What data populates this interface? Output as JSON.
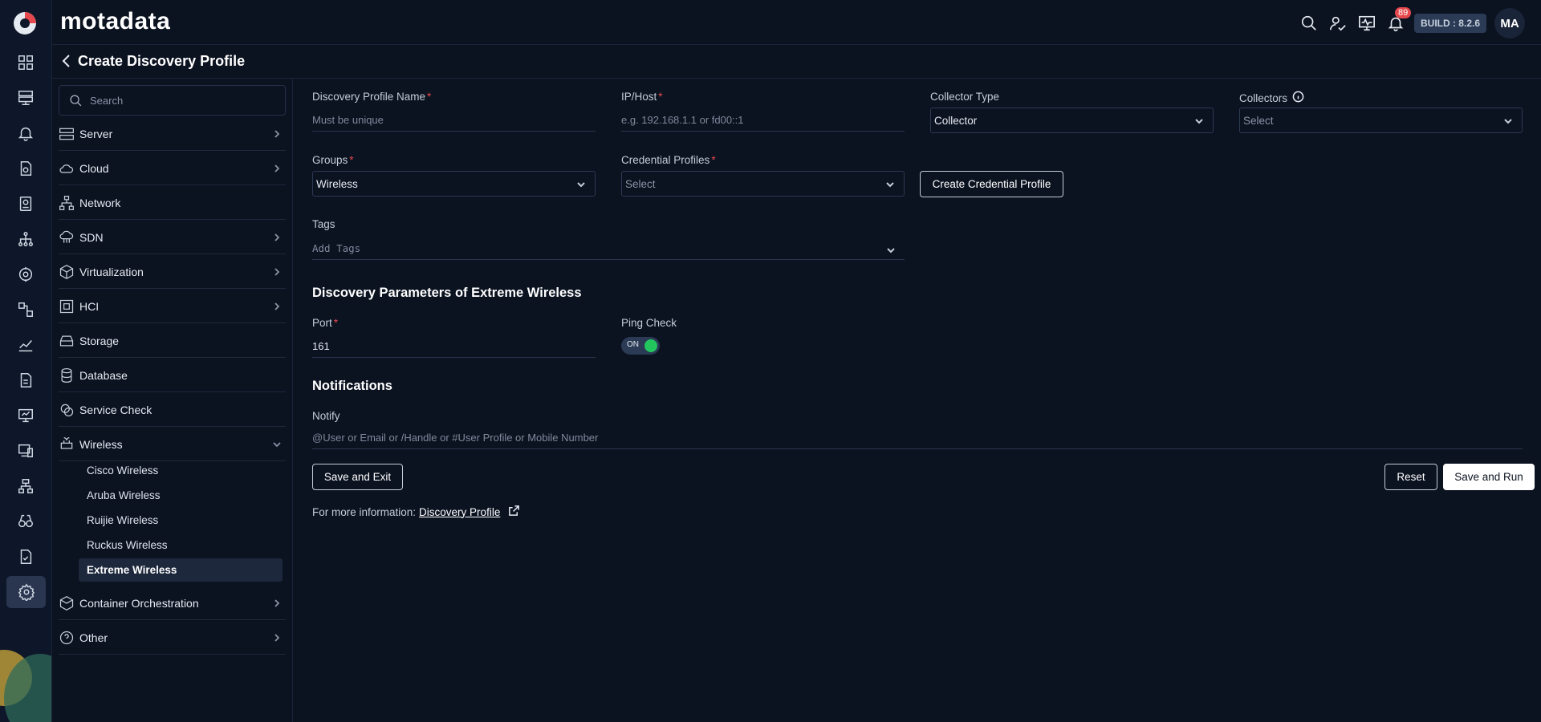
{
  "brand": {
    "name": "motadata"
  },
  "header": {
    "notifications_count": "89",
    "build_label": "BUILD : 8.2.6",
    "avatar_initials": "MA"
  },
  "page": {
    "title": "Create Discovery Profile"
  },
  "sidebar": {
    "search_placeholder": "Search",
    "categories": [
      {
        "label": "Server",
        "icon": "server-icon"
      },
      {
        "label": "Cloud",
        "icon": "cloud-icon"
      },
      {
        "label": "Network",
        "icon": "network-icon"
      },
      {
        "label": "SDN",
        "icon": "sdn-icon"
      },
      {
        "label": "Virtualization",
        "icon": "cube-icon"
      },
      {
        "label": "HCI",
        "icon": "hci-icon"
      },
      {
        "label": "Storage",
        "icon": "storage-icon"
      },
      {
        "label": "Database",
        "icon": "database-icon"
      },
      {
        "label": "Service Check",
        "icon": "service-check-icon"
      },
      {
        "label": "Wireless",
        "icon": "wireless-icon"
      },
      {
        "label": "Container Orchestration",
        "icon": "container-icon"
      },
      {
        "label": "Other",
        "icon": "question-icon"
      }
    ],
    "wireless_items": [
      "Cisco Wireless",
      "Aruba Wireless",
      "Ruijie Wireless",
      "Ruckus Wireless",
      "Extreme Wireless"
    ],
    "active_item": "Extreme Wireless"
  },
  "form": {
    "profile_name": {
      "label": "Discovery Profile Name",
      "placeholder": "Must be unique"
    },
    "ip_host": {
      "label": "IP/Host",
      "placeholder": "e.g. 192.168.1.1 or fd00::1"
    },
    "collector_type": {
      "label": "Collector Type",
      "value": "Collector"
    },
    "collectors": {
      "label": "Collectors",
      "placeholder": "Select"
    },
    "groups": {
      "label": "Groups",
      "value": "Wireless"
    },
    "credential_profiles": {
      "label": "Credential Profiles",
      "placeholder": "Select"
    },
    "create_credential_label": "Create Credential Profile",
    "tags": {
      "label": "Tags",
      "placeholder": "Add Tags"
    },
    "params_title": "Discovery Parameters of Extreme Wireless",
    "port": {
      "label": "Port",
      "value": "161"
    },
    "ping_check": {
      "label": "Ping Check",
      "state": "ON"
    },
    "notifications_title": "Notifications",
    "notify": {
      "label": "Notify",
      "placeholder": "@User or Email or /Handle or #User Profile or Mobile Number"
    },
    "save_exit_label": "Save and Exit",
    "reset_label": "Reset",
    "save_run_label": "Save and Run",
    "more_info_prefix": "For more information:",
    "more_info_link": "Discovery Profile"
  },
  "colors": {
    "accent_green": "#22c55e",
    "required_red": "#e5484d",
    "background": "#0b1220"
  }
}
